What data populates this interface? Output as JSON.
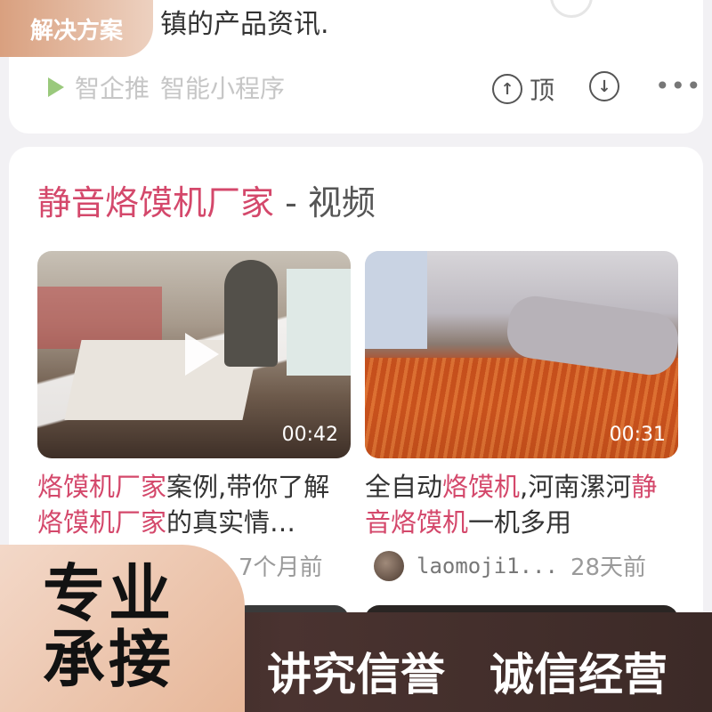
{
  "top_result": {
    "title_fragment": "镇的产品资讯.",
    "source_name": "智企推",
    "source_type": "智能小程序",
    "vote_up_label": "顶"
  },
  "solution_badge": {
    "label": "解决方案"
  },
  "video_section": {
    "title_keyword": "静音烙馍机厂家",
    "title_separator": " - ",
    "title_suffix": "视频",
    "videos": [
      {
        "duration": "00:42",
        "title_parts": [
          {
            "text": "烙馍机厂家",
            "highlight": true
          },
          {
            "text": "案例,带你了解",
            "highlight": false
          },
          {
            "text": "烙馍机厂家",
            "highlight": true
          },
          {
            "text": "的真实情…",
            "highlight": false
          }
        ],
        "age": "7个月前"
      },
      {
        "duration": "00:31",
        "title_parts": [
          {
            "text": "全自动",
            "highlight": false
          },
          {
            "text": "烙馍机",
            "highlight": true
          },
          {
            "text": ",河南漯河",
            "highlight": false
          },
          {
            "text": "静音烙馍机",
            "highlight": true
          },
          {
            "text": "一机多用",
            "highlight": false
          }
        ],
        "author": "laomoji1...",
        "age": "28天前"
      }
    ]
  },
  "banner": {
    "label_line1": "专业",
    "label_line2": "承接",
    "slogan_1": "讲究信誉",
    "slogan_2": "诚信经营"
  },
  "colors": {
    "highlight": "#d4486b",
    "badge": "#d9a07f",
    "banner_dark": "#3c2a27",
    "banner_light": "#f3d8c8"
  }
}
